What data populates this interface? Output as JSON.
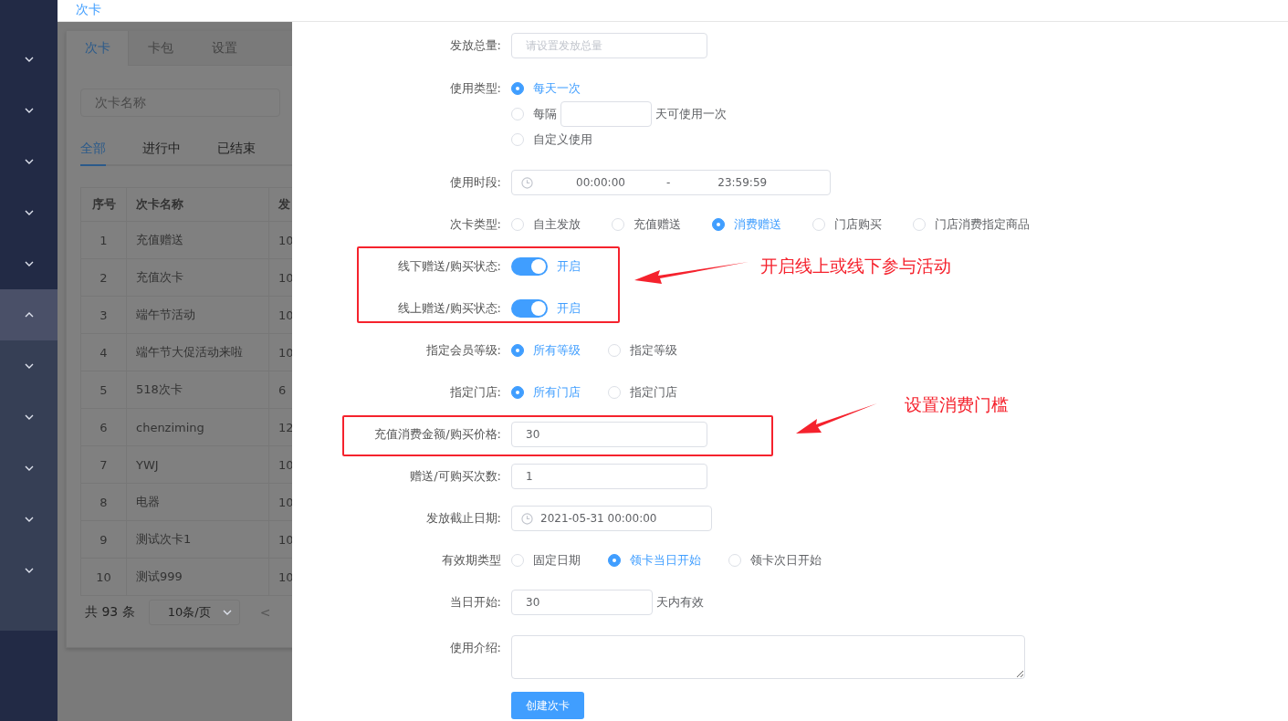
{
  "header": {
    "title": "次卡"
  },
  "sidebar": {
    "items": [
      {
        "expanded": false
      },
      {
        "expanded": false
      },
      {
        "expanded": false
      },
      {
        "expanded": false
      },
      {
        "expanded": false
      },
      {
        "expanded": true,
        "children": [
          {
            "expanded": false
          },
          {
            "expanded": false
          },
          {
            "expanded": false
          },
          {
            "expanded": false
          },
          {
            "expanded": false
          }
        ]
      }
    ]
  },
  "background_page": {
    "tabs": [
      {
        "label": "次卡",
        "selected": true
      },
      {
        "label": "卡包",
        "selected": false
      },
      {
        "label": "设置",
        "selected": false
      }
    ],
    "search": {
      "placeholder": "次卡名称"
    },
    "filters": [
      {
        "label": "全部",
        "selected": true
      },
      {
        "label": "进行中",
        "selected": false
      },
      {
        "label": "已结束",
        "selected": false
      }
    ],
    "table": {
      "columns": [
        "序号",
        "次卡名称",
        "发"
      ],
      "rows": [
        [
          "1",
          "充值赠送",
          "10"
        ],
        [
          "2",
          "充值次卡",
          "10"
        ],
        [
          "3",
          "端午节活动",
          "10"
        ],
        [
          "4",
          "端午节大促活动来啦",
          "10"
        ],
        [
          "5",
          "518次卡",
          "6"
        ],
        [
          "6",
          "chenziming",
          "12"
        ],
        [
          "7",
          "YWJ",
          "10"
        ],
        [
          "8",
          "电器",
          "10"
        ],
        [
          "9",
          "测试次卡1",
          "10"
        ],
        [
          "10",
          "测试999",
          "10"
        ]
      ]
    },
    "pagination": {
      "total": "共 93 条",
      "page_size": "10条/页",
      "prev": "<"
    }
  },
  "form": {
    "fields": [
      {
        "kind": "input",
        "label": "发放总量:",
        "placeholder": "请设置发放总量"
      },
      {
        "kind": "radio_stack",
        "label": "使用类型:",
        "options": [
          {
            "label": "每天一次",
            "selected": true
          },
          {
            "label": "每隔",
            "selected": false,
            "has_input": true,
            "suffix": "天可使用一次"
          },
          {
            "label": "自定义使用",
            "selected": false
          }
        ]
      },
      {
        "kind": "time_range",
        "label": "使用时段:",
        "start": "00:00:00",
        "separator": "-",
        "end": "23:59:59"
      },
      {
        "kind": "radio_row",
        "label": "次卡类型:",
        "options": [
          {
            "label": "自主发放",
            "selected": false
          },
          {
            "label": "充值赠送",
            "selected": false
          },
          {
            "label": "消费赠送",
            "selected": true
          },
          {
            "label": "门店购买",
            "selected": false
          },
          {
            "label": "门店消费指定商品",
            "selected": false
          }
        ]
      },
      {
        "kind": "switch",
        "label": "线下赠送/购买状态:",
        "on": true,
        "text": "开启"
      },
      {
        "kind": "switch",
        "label": "线上赠送/购买状态:",
        "on": true,
        "text": "开启"
      },
      {
        "kind": "radio_row",
        "label": "指定会员等级:",
        "options": [
          {
            "label": "所有等级",
            "selected": true
          },
          {
            "label": "指定等级",
            "selected": false
          }
        ]
      },
      {
        "kind": "radio_row",
        "label": "指定门店:",
        "options": [
          {
            "label": "所有门店",
            "selected": true
          },
          {
            "label": "指定门店",
            "selected": false
          }
        ]
      },
      {
        "kind": "input",
        "label": "充值消费金额/购买价格:",
        "value": "30"
      },
      {
        "kind": "input",
        "label": "赠送/可购买次数:",
        "value": "1"
      },
      {
        "kind": "date",
        "label": "发放截止日期:",
        "value": "2021-05-31 00:00:00"
      },
      {
        "kind": "radio_row",
        "label": "有效期类型",
        "options": [
          {
            "label": "固定日期",
            "selected": false
          },
          {
            "label": "领卡当日开始",
            "selected": true
          },
          {
            "label": "领卡次日开始",
            "selected": false
          }
        ]
      },
      {
        "kind": "input_suffix",
        "label": "当日开始:",
        "value": "30",
        "suffix": "天内有效"
      },
      {
        "kind": "textarea",
        "label": "使用介绍:"
      }
    ],
    "submit_button": "创建次卡"
  },
  "annotations": [
    {
      "text": "开启线上或线下参与活动"
    },
    {
      "text": "设置消费门槛"
    }
  ]
}
